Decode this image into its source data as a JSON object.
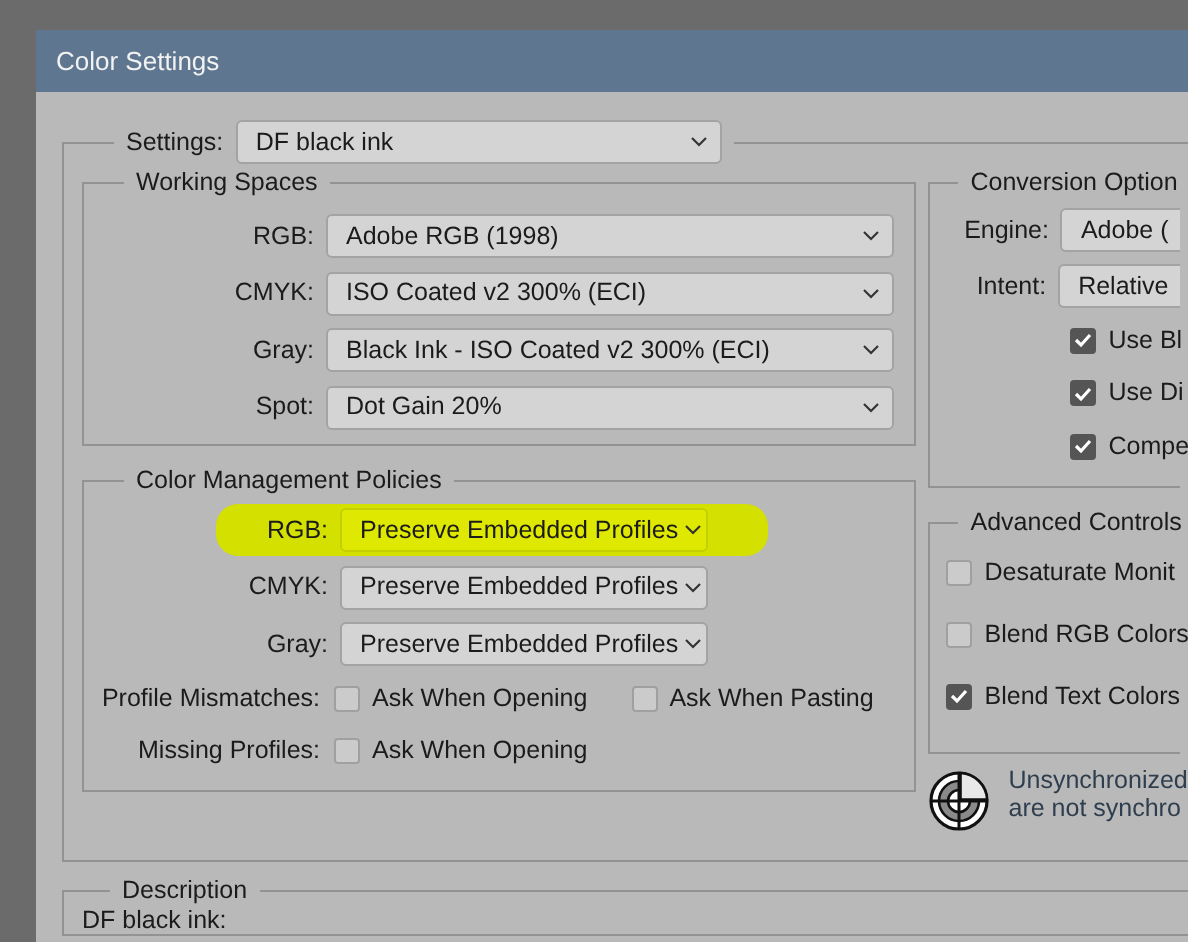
{
  "window": {
    "title": "Color Settings"
  },
  "settings": {
    "label": "Settings:",
    "value": "DF black ink"
  },
  "working_spaces": {
    "title": "Working Spaces",
    "rows": [
      {
        "label": "RGB:",
        "value": "Adobe RGB (1998)"
      },
      {
        "label": "CMYK:",
        "value": "ISO Coated v2 300% (ECI)"
      },
      {
        "label": "Gray:",
        "value": "Black Ink - ISO Coated v2 300% (ECI)"
      },
      {
        "label": "Spot:",
        "value": "Dot Gain 20%"
      }
    ]
  },
  "policies": {
    "title": "Color Management Policies",
    "rows": [
      {
        "label": "RGB:",
        "value": "Preserve Embedded Profiles",
        "highlighted": true
      },
      {
        "label": "CMYK:",
        "value": "Preserve Embedded Profiles",
        "highlighted": false
      },
      {
        "label": "Gray:",
        "value": "Preserve Embedded Profiles",
        "highlighted": false
      }
    ],
    "checks": [
      {
        "label": "Profile Mismatches:",
        "options": [
          {
            "label": "Ask When Opening",
            "checked": false
          },
          {
            "label": "Ask When Pasting",
            "checked": false
          }
        ]
      },
      {
        "label": "Missing Profiles:",
        "options": [
          {
            "label": "Ask When Opening",
            "checked": false
          }
        ]
      }
    ]
  },
  "conversion": {
    "title": "Conversion Option",
    "rows": [
      {
        "label": "Engine:",
        "value": "Adobe ("
      },
      {
        "label": "Intent:",
        "value": "Relative"
      }
    ],
    "options": [
      {
        "label": "Use Bl",
        "checked": true
      },
      {
        "label": "Use Di",
        "checked": true
      },
      {
        "label": "Compe",
        "checked": true
      }
    ]
  },
  "advanced": {
    "title": "Advanced Controls",
    "options": [
      {
        "label": "Desaturate Monit",
        "checked": false
      },
      {
        "label": "Blend RGB Colors",
        "checked": false
      },
      {
        "label": "Blend Text Colors",
        "checked": true
      }
    ]
  },
  "sync_notice": [
    "Unsynchronized",
    "are not synchro"
  ],
  "description": {
    "title": "Description",
    "text": "DF black ink:"
  }
}
